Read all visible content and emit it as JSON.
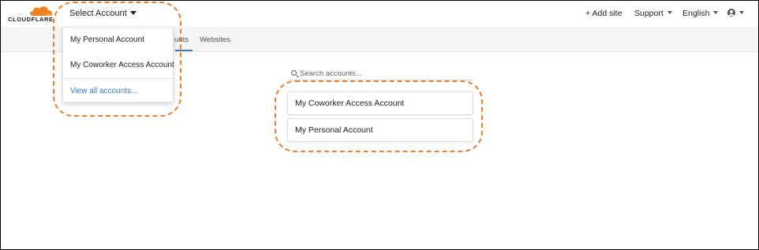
{
  "brand": {
    "logo_text": "CLOUDFLARE",
    "cloud_color": "#f38020"
  },
  "header": {
    "select_account_label": "Select Account",
    "add_site_label": "+ Add site",
    "support_label": "Support",
    "language_label": "English"
  },
  "subnav": {
    "tabs": [
      {
        "label": "unts",
        "active": true
      },
      {
        "label": "Websites",
        "active": false
      }
    ]
  },
  "account_dropdown": {
    "items": [
      {
        "label": "My Personal Account"
      },
      {
        "label": "My Coworker Access Account"
      }
    ],
    "view_all_label": "View all accounts..."
  },
  "search": {
    "placeholder": "Search accounts..."
  },
  "accounts_list": [
    {
      "label": "My Coworker Access Account"
    },
    {
      "label": "My Personal Account"
    }
  ],
  "colors": {
    "highlight": "#e8822e",
    "link": "#2c7cc4",
    "tab_active": "#3b7dd8"
  },
  "icons": {
    "search": "search-icon",
    "user": "user-icon",
    "caret": "caret-down-icon"
  }
}
